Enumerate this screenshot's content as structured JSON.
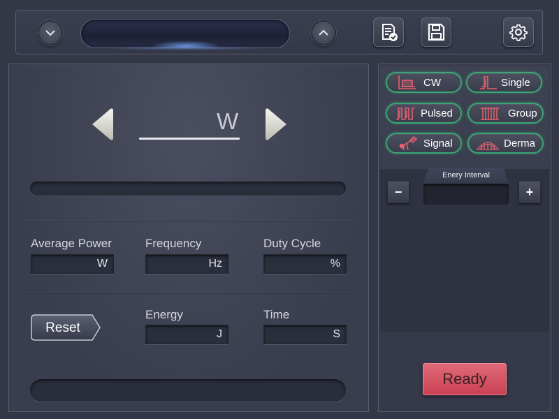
{
  "top": {
    "prev_icon": "chevron-down-icon",
    "next_icon": "chevron-up-icon",
    "record_icon": "report-check-icon",
    "save_icon": "floppy-disk-icon",
    "settings_icon": "gear-icon"
  },
  "power": {
    "unit": "W",
    "decrease_icon": "triangle-left-icon",
    "increase_icon": "triangle-right-icon"
  },
  "fields": {
    "average_power": {
      "label": "Average Power",
      "unit": "W"
    },
    "frequency": {
      "label": "Frequency",
      "unit": "Hz"
    },
    "duty_cycle": {
      "label": "Duty Cycle",
      "unit": "%"
    },
    "energy": {
      "label": "Energy",
      "unit": "J"
    },
    "time": {
      "label": "Time",
      "unit": "S"
    }
  },
  "reset_label": "Reset",
  "modes": [
    {
      "label": "CW",
      "icon": "cw-wave-icon"
    },
    {
      "label": "Single",
      "icon": "single-pulse-icon"
    },
    {
      "label": "Pulsed",
      "icon": "pulsed-wave-icon"
    },
    {
      "label": "Group",
      "icon": "group-pulse-icon"
    },
    {
      "label": "Signal",
      "icon": "signal-icon"
    },
    {
      "label": "Derma",
      "icon": "derma-icon"
    }
  ],
  "interval": {
    "label": "Enery Interval",
    "minus": "−",
    "plus": "+"
  },
  "ready_label": "Ready",
  "colors": {
    "accent_green": "#3aa575",
    "icon_red": "#e4606e",
    "ready_red": "#d45463"
  }
}
